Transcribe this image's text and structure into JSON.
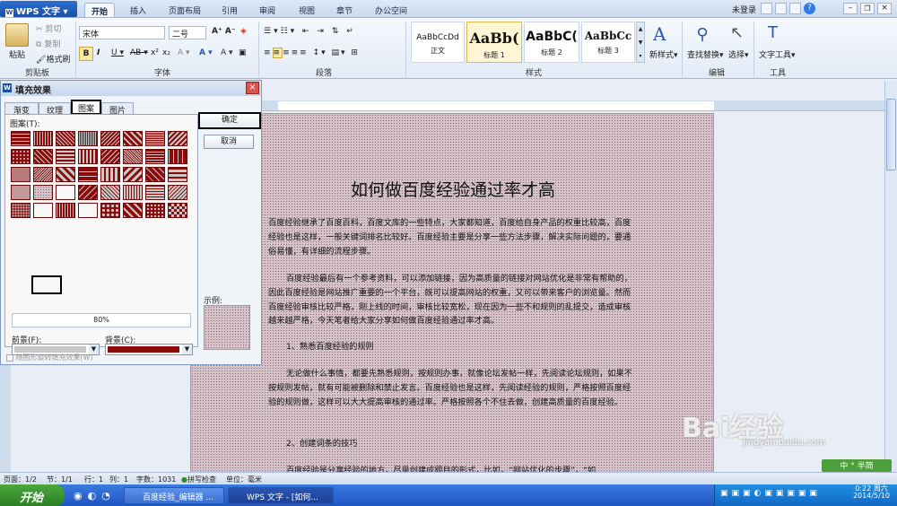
{
  "app": {
    "title": "WPS 文字",
    "login": "未登录"
  },
  "menu": {
    "tabs": [
      "开始",
      "插入",
      "页面布局",
      "引用",
      "审阅",
      "视图",
      "章节",
      "办公空间"
    ],
    "active": "开始"
  },
  "ribbon": {
    "clipboard": {
      "paste": "粘贴",
      "cut": "剪切",
      "copy": "复制",
      "format_painter": "格式刷",
      "label": "剪贴板"
    },
    "font": {
      "name": "宋体",
      "size": "二号",
      "label": "字体"
    },
    "paragraph": {
      "label": "段落"
    },
    "styles": {
      "label": "样式",
      "items": [
        {
          "preview": "AaBbCcDd",
          "name": "正文"
        },
        {
          "preview": "AaBb(",
          "name": "标题 1"
        },
        {
          "preview": "AaBbC(",
          "name": "标题 2"
        },
        {
          "preview": "AaBbCc",
          "name": "标题 3"
        }
      ]
    },
    "new_style": "新样式",
    "find_replace": "查找替换",
    "select": "选择",
    "edit_label": "编辑",
    "text_tools": "文字工具",
    "tools_label": "工具"
  },
  "dialog": {
    "title": "填充效果",
    "tabs": [
      "渐变",
      "纹理",
      "图案",
      "图片"
    ],
    "active_tab": "图案",
    "pattern_label": "图案(T):",
    "percent": "80%",
    "foreground_label": "前景(F):",
    "background_label": "背景(C):",
    "sample_label": "示例:",
    "checkbox": "随图形旋转填充效果(W)",
    "ok": "确定",
    "cancel": "取消",
    "foreground_color": "#c8c8c8",
    "background_color": "#8b0a0a"
  },
  "document": {
    "title": "如何做百度经验通过率才高",
    "paragraphs": [
      "百度经验继承了百度百科，百度文库的一些特点，大家都知道，百度给自身产品的权重比较高，百度经验也是这样，一般关键词排名比较好。百度经验主要是分享一些方法步骤，解决实际问题的，要通俗易懂，有详细的流程步骤。",
      "百度经验最后有一个参考资料，可以添加链接，因为高质量的链接对网站优化是非常有帮助的，因此百度经验是网站推广重要的一个平台，既可以提高网站的权重，又可以带来客户的浏览量。然而百度经验审核比较严格，刚上线的时间，审核比较宽松，现在因为一些不和规则的乱提交，造成审核越来越严格，今天笔者给大家分享如何做百度经验通过率才高。",
      "1、熟悉百度经验的规则",
      "无论做什么事情，都要先熟悉规则，按规则办事，就像论坛发帖一样，先阅读论坛规则，如果不按规则发帖，就有可能被删除和禁止发言。百度经验也是这样，先阅读经验的规则，严格按照百度经验的规则做，这样可以大大提高审核的通过率。严格按照各个不住去做，创建高质量的百度经验。",
      "2、创建词条的技巧",
      "百度经验是分享经验的地方，尽量创建成题目的形式，比如，“网站优化的步骤”，“如"
    ]
  },
  "status": {
    "page": "页面：1/2",
    "section": "节：1/1",
    "row": "行：1",
    "col": "列：1",
    "words": "字数：1031",
    "spell": "拼写检查",
    "unit": "单位：毫米"
  },
  "taskbar": {
    "start": "开始",
    "tasks": [
      "百度经验_编辑器 ...",
      "WPS 文字 - [如何..."
    ],
    "time": "0:22 周六",
    "date": "2014/5/10"
  },
  "watermark": {
    "brand": "Bai经验",
    "url": "jingyan.baidu.com"
  },
  "ime": "中 ° 半简"
}
